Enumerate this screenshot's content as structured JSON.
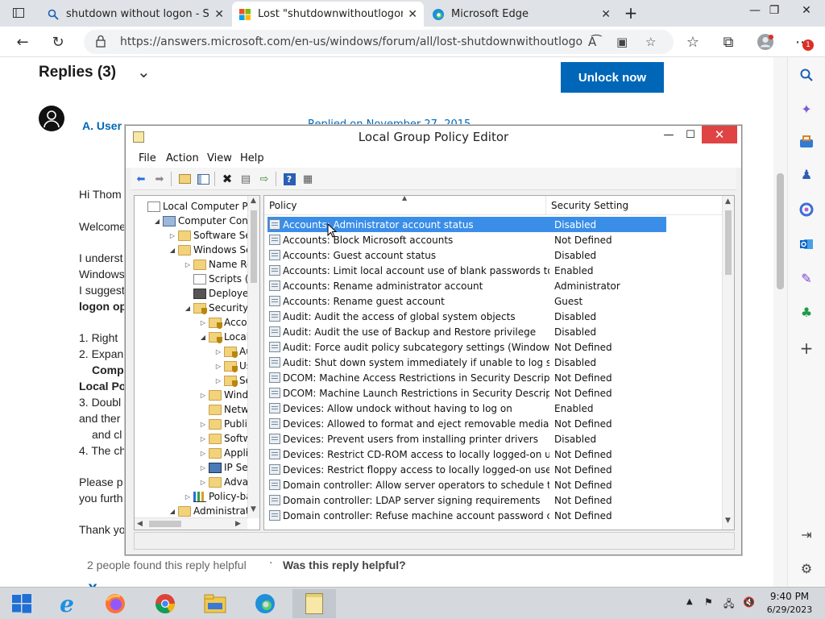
{
  "browser": {
    "tabs": [
      {
        "label": "shutdown without logon - Search",
        "icon": "search-icon"
      },
      {
        "label": "Lost \"shutdownwithoutlogon\" b",
        "icon": "microsoft-logo-icon"
      },
      {
        "label": "Microsoft Edge",
        "icon": "edge-logo-icon"
      }
    ],
    "url": "https://answers.microsoft.com/en-us/windows/forum/all/lost-shutdownwithoutlogon-butt...",
    "profile_badge": "1"
  },
  "page": {
    "replies_heading": "Replies (3)",
    "unlock_button": "Unlock now",
    "author": "A. User",
    "replied_on": "Replied on November 27, 2015",
    "body_lines": [
      "Hi Thom",
      "Welcome",
      "I underst",
      "Windows",
      "I suggest",
      "logon op",
      "1. Right",
      "2. Expan",
      "Comp",
      "Local Po",
      "3. Doubl",
      "and ther",
      "and cl",
      "4. The ch",
      "Please p",
      "you furth",
      "Thank yo"
    ],
    "helpful_count": "2 people found this reply helpful",
    "helpful_question": "Was this reply helpful?",
    "next_author": "Y"
  },
  "gpe": {
    "title": "Local Group Policy Editor",
    "menu": [
      "File",
      "Action",
      "View",
      "Help"
    ],
    "tree": [
      {
        "label": "Local Computer Polic",
        "icon": "doc",
        "indent": 0,
        "twisty": ""
      },
      {
        "label": "Computer Configu",
        "icon": "computer",
        "indent": 1,
        "twisty": "◢"
      },
      {
        "label": "Software Setti",
        "icon": "folder",
        "indent": 2,
        "twisty": "▷"
      },
      {
        "label": "Windows Sett",
        "icon": "folder",
        "indent": 2,
        "twisty": "◢"
      },
      {
        "label": "Name Res",
        "icon": "folder",
        "indent": 3,
        "twisty": "▷"
      },
      {
        "label": "Scripts (Sta",
        "icon": "doc",
        "indent": 3,
        "twisty": ""
      },
      {
        "label": "Deployed",
        "icon": "printer",
        "indent": 3,
        "twisty": ""
      },
      {
        "label": "Security Se",
        "icon": "shield",
        "indent": 3,
        "twisty": "◢"
      },
      {
        "label": "Accou",
        "icon": "shield",
        "indent": 4,
        "twisty": "▷"
      },
      {
        "label": "Local P",
        "icon": "shield",
        "indent": 4,
        "twisty": "◢"
      },
      {
        "label": "Au",
        "icon": "shield",
        "indent": 5,
        "twisty": "▷"
      },
      {
        "label": "Use",
        "icon": "shield",
        "indent": 5,
        "twisty": "▷"
      },
      {
        "label": "Sec",
        "icon": "shield",
        "indent": 5,
        "twisty": "▷"
      },
      {
        "label": "Windo",
        "icon": "folder",
        "indent": 4,
        "twisty": "▷"
      },
      {
        "label": "Netwo",
        "icon": "folder",
        "indent": 4,
        "twisty": ""
      },
      {
        "label": "Public",
        "icon": "folder",
        "indent": 4,
        "twisty": "▷"
      },
      {
        "label": "Softwa",
        "icon": "folder",
        "indent": 4,
        "twisty": "▷"
      },
      {
        "label": "Applic",
        "icon": "folder",
        "indent": 4,
        "twisty": "▷"
      },
      {
        "label": "IP Secu",
        "icon": "ipsec",
        "indent": 4,
        "twisty": "▷"
      },
      {
        "label": "Advan",
        "icon": "folder",
        "indent": 4,
        "twisty": "▷"
      },
      {
        "label": "Policy-bas",
        "icon": "chart",
        "indent": 3,
        "twisty": "▷"
      },
      {
        "label": "Administrative",
        "icon": "folder",
        "indent": 2,
        "twisty": "◢"
      }
    ],
    "columns": {
      "policy": "Policy",
      "setting": "Security Setting"
    },
    "policies": [
      {
        "name": "Accounts: Administrator account status",
        "setting": "Disabled",
        "selected": true
      },
      {
        "name": "Accounts: Block Microsoft accounts",
        "setting": "Not Defined"
      },
      {
        "name": "Accounts: Guest account status",
        "setting": "Disabled"
      },
      {
        "name": "Accounts: Limit local account use of blank passwords to co...",
        "setting": "Enabled"
      },
      {
        "name": "Accounts: Rename administrator account",
        "setting": "Administrator"
      },
      {
        "name": "Accounts: Rename guest account",
        "setting": "Guest"
      },
      {
        "name": "Audit: Audit the access of global system objects",
        "setting": "Disabled"
      },
      {
        "name": "Audit: Audit the use of Backup and Restore privilege",
        "setting": "Disabled"
      },
      {
        "name": "Audit: Force audit policy subcategory settings (Windows Vis...",
        "setting": "Not Defined"
      },
      {
        "name": "Audit: Shut down system immediately if unable to log secur...",
        "setting": "Disabled"
      },
      {
        "name": "DCOM: Machine Access Restrictions in Security Descriptor D...",
        "setting": "Not Defined"
      },
      {
        "name": "DCOM: Machine Launch Restrictions in Security Descriptor ...",
        "setting": "Not Defined"
      },
      {
        "name": "Devices: Allow undock without having to log on",
        "setting": "Enabled"
      },
      {
        "name": "Devices: Allowed to format and eject removable media",
        "setting": "Not Defined"
      },
      {
        "name": "Devices: Prevent users from installing printer drivers",
        "setting": "Disabled"
      },
      {
        "name": "Devices: Restrict CD-ROM access to locally logged-on user ...",
        "setting": "Not Defined"
      },
      {
        "name": "Devices: Restrict floppy access to locally logged-on user only",
        "setting": "Not Defined"
      },
      {
        "name": "Domain controller: Allow server operators to schedule tasks",
        "setting": "Not Defined"
      },
      {
        "name": "Domain controller: LDAP server signing requirements",
        "setting": "Not Defined"
      },
      {
        "name": "Domain controller: Refuse machine account password chan...",
        "setting": "Not Defined"
      }
    ]
  },
  "taskbar": {
    "time": "9:40 PM",
    "date": "6/29/2023"
  },
  "colors": {
    "accent": "#0067b8",
    "selection": "#3a8ee8",
    "close_red": "#e04343"
  }
}
